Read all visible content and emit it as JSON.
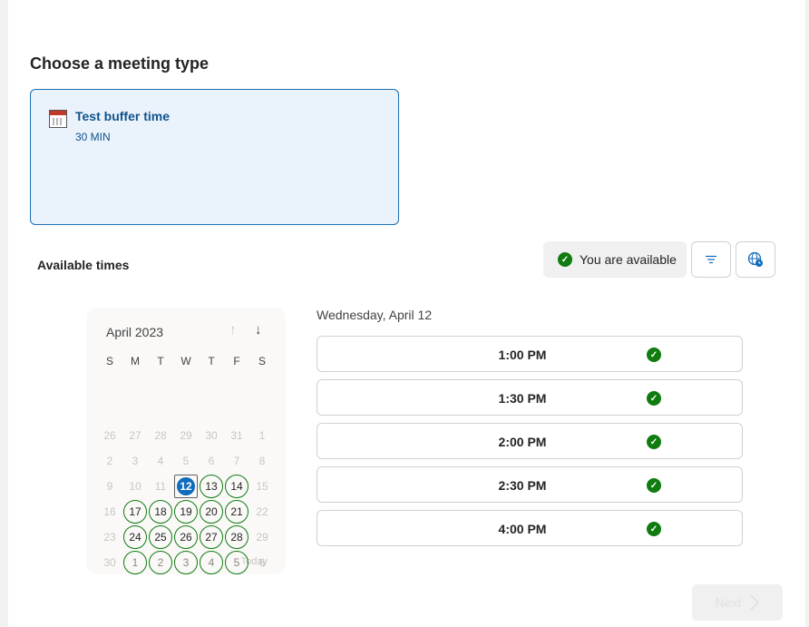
{
  "heading": "Choose a meeting type",
  "meeting_type": {
    "name": "Test buffer time",
    "duration": "30 MIN"
  },
  "available_times_label": "Available times",
  "availability_status": "You are available",
  "calendar": {
    "month": "April 2023",
    "weekdays": [
      "S",
      "M",
      "T",
      "W",
      "T",
      "F",
      "S"
    ],
    "weeks": [
      [
        [
          "26",
          "muted"
        ],
        [
          "27",
          "muted"
        ],
        [
          "28",
          "muted"
        ],
        [
          "29",
          "muted"
        ],
        [
          "30",
          "muted"
        ],
        [
          "31",
          "muted"
        ],
        [
          "1",
          "muted"
        ]
      ],
      [
        [
          "2",
          "muted"
        ],
        [
          "3",
          "muted"
        ],
        [
          "4",
          "muted"
        ],
        [
          "5",
          "muted"
        ],
        [
          "6",
          "muted"
        ],
        [
          "7",
          "muted"
        ],
        [
          "8",
          "muted"
        ]
      ],
      [
        [
          "9",
          "muted"
        ],
        [
          "10",
          "muted"
        ],
        [
          "11",
          "muted"
        ],
        [
          "12",
          "sel"
        ],
        [
          "13",
          "avail"
        ],
        [
          "14",
          "avail"
        ],
        [
          "15",
          "muted"
        ]
      ],
      [
        [
          "16",
          "muted"
        ],
        [
          "17",
          "avail"
        ],
        [
          "18",
          "avail"
        ],
        [
          "19",
          "avail"
        ],
        [
          "20",
          "avail"
        ],
        [
          "21",
          "avail"
        ],
        [
          "22",
          "muted"
        ]
      ],
      [
        [
          "23",
          "muted"
        ],
        [
          "24",
          "avail"
        ],
        [
          "25",
          "avail"
        ],
        [
          "26",
          "avail"
        ],
        [
          "27",
          "avail"
        ],
        [
          "28",
          "avail"
        ],
        [
          "29",
          "muted"
        ]
      ],
      [
        [
          "30",
          "muted"
        ],
        [
          "1",
          "availmuted"
        ],
        [
          "2",
          "availmuted"
        ],
        [
          "3",
          "availmuted"
        ],
        [
          "4",
          "availmuted"
        ],
        [
          "5",
          "availmuted"
        ],
        [
          "6",
          "muted"
        ]
      ]
    ],
    "today_label": "Today"
  },
  "selected_date_label": "Wednesday, April 12",
  "time_slots": [
    "1:00 PM",
    "1:30 PM",
    "2:00 PM",
    "2:30 PM",
    "4:00 PM"
  ],
  "next_label": "Next",
  "colors": {
    "accent": "#0f6cbd",
    "available": "#107c10",
    "card_bg": "#eaf2fb"
  }
}
